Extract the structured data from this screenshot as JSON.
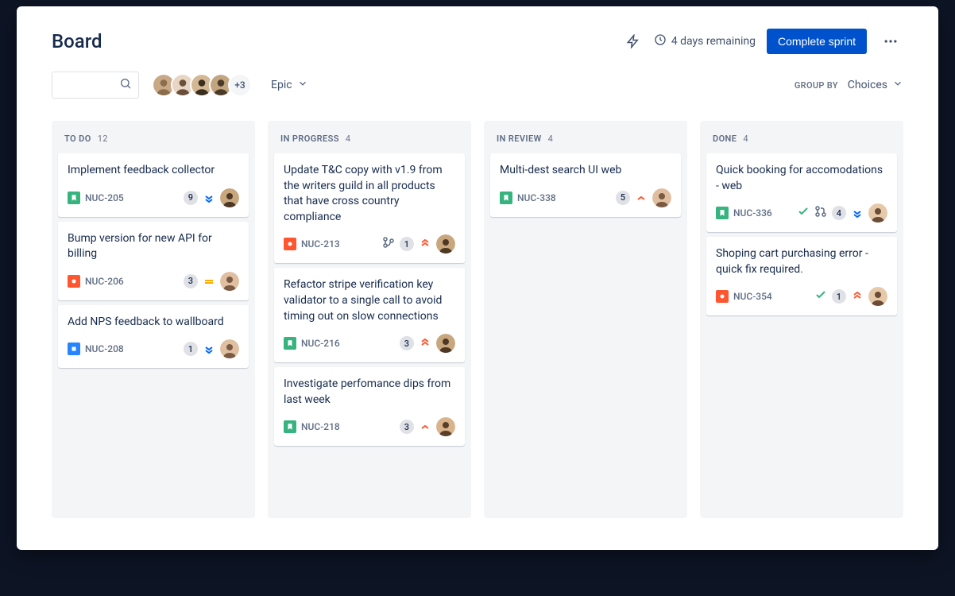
{
  "header": {
    "title": "Board",
    "remaining": "4 days remaining",
    "complete_label": "Complete sprint"
  },
  "toolbar": {
    "epic_label": "Epic",
    "avatar_more": "+3",
    "group_by_label": "GROUP BY",
    "choices_label": "Choices"
  },
  "columns": [
    {
      "name": "TO DO",
      "count": "12"
    },
    {
      "name": "IN PROGRESS",
      "count": "4"
    },
    {
      "name": "IN REVIEW",
      "count": "4"
    },
    {
      "name": "DONE",
      "count": "4"
    }
  ],
  "cards": {
    "todo": [
      {
        "title": "Implement feedback collector",
        "key": "NUC-205",
        "type": "story",
        "points": "9",
        "priority": "low"
      },
      {
        "title": "Bump version for new API for billing",
        "key": "NUC-206",
        "type": "bug",
        "points": "3",
        "priority": "medium"
      },
      {
        "title": "Add NPS feedback to wallboard",
        "key": "NUC-208",
        "type": "task",
        "points": "1",
        "priority": "low"
      }
    ],
    "inprogress": [
      {
        "title": "Update T&C copy with v1.9 from the writers guild in all products that have cross country compliance",
        "key": "NUC-213",
        "type": "bug",
        "points": "1",
        "priority": "highest",
        "branch": true
      },
      {
        "title": "Refactor stripe verification key validator to a single call to avoid timing out on slow connections",
        "key": "NUC-216",
        "type": "story",
        "points": "3",
        "priority": "highest"
      },
      {
        "title": "Investigate perfomance dips from last week",
        "key": "NUC-218",
        "type": "story",
        "points": "3",
        "priority": "high"
      }
    ],
    "inreview": [
      {
        "title": "Multi-dest search UI web",
        "key": "NUC-338",
        "type": "story",
        "points": "5",
        "priority": "high"
      }
    ],
    "done": [
      {
        "title": "Quick booking for accomodations - web",
        "key": "NUC-336",
        "type": "story",
        "points": "4",
        "priority": "low",
        "check": true,
        "pr": true
      },
      {
        "title": "Shoping cart purchasing error - quick fix required.",
        "key": "NUC-354",
        "type": "bug",
        "points": "1",
        "priority": "highest",
        "check": true
      }
    ]
  }
}
